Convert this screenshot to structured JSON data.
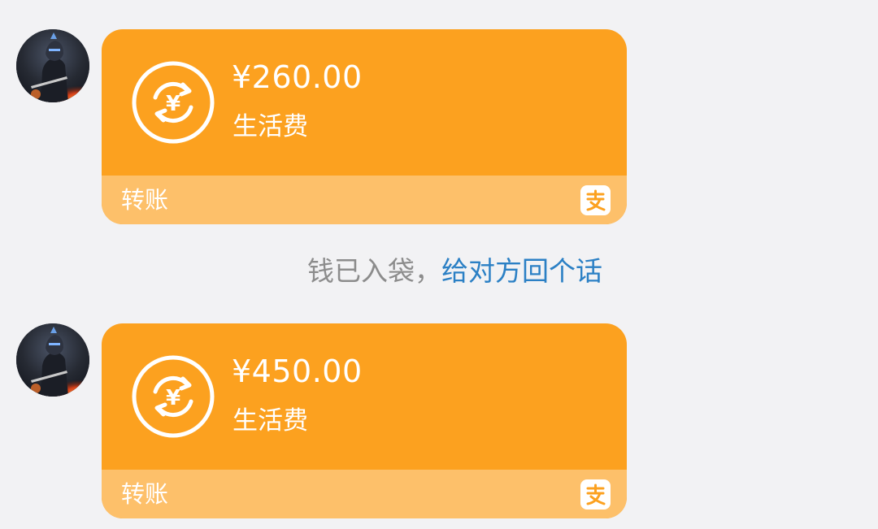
{
  "messages": [
    {
      "amount": "¥260.00",
      "memo": "生活费",
      "footer_label": "转账",
      "icon": "currency-exchange-icon",
      "footer_icon": "alipay-icon"
    },
    {
      "amount": "¥450.00",
      "memo": "生活费",
      "footer_label": "转账",
      "icon": "currency-exchange-icon",
      "footer_icon": "alipay-icon"
    }
  ],
  "notice": {
    "text": "钱已入袋，",
    "link": "给对方回个话"
  },
  "colors": {
    "card": "#fca11f",
    "card_footer": "#fdc06a",
    "link": "#2b80c5",
    "notice_text": "#8c8c8c",
    "background": "#f2f2f4"
  }
}
